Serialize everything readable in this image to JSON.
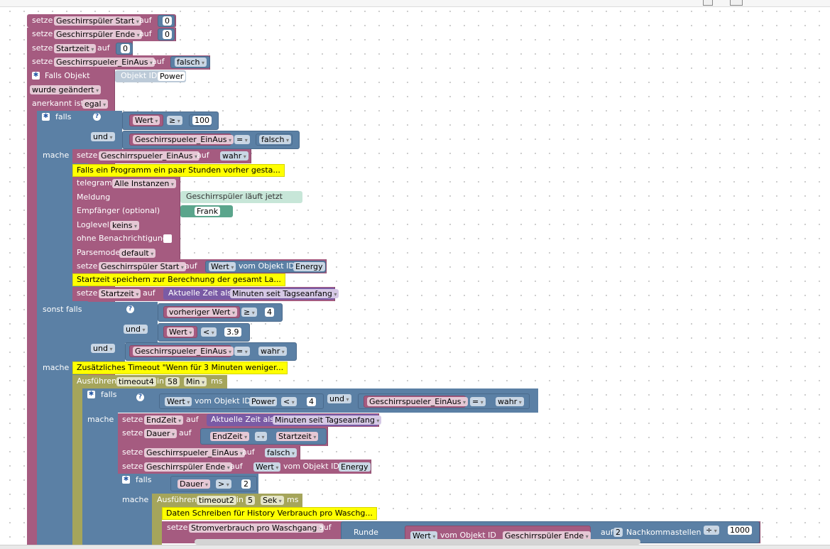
{
  "colors": {
    "variable": "#a55b80",
    "logic": "#5b80a5",
    "timeout": "#a5a55b",
    "time": "#7a5ba5",
    "text": "#5ba58c",
    "comment": "#ffff00"
  },
  "k": {
    "setze": "setze",
    "auf": "auf",
    "falls": "falls",
    "sonst_falls": "sonst falls",
    "mache": "mache",
    "und": "und",
    "vom_objekt_id": "vom Objekt ID",
    "ausfuehren": "Ausführen",
    "in": "in",
    "ms": "ms",
    "falls_objekt": "Falls Objekt",
    "objekt_id": "Objekt ID",
    "wurde_geaendert": "wurde geändert",
    "anerkannt_ist": "anerkannt ist",
    "egal": "egal",
    "aktuelle_zeit_als": "Aktuelle Zeit als",
    "minuten_seit": "Minuten seit Tagseanfang",
    "runde": "Runde",
    "nachkommastellen": "Nachkommastellen"
  },
  "v": {
    "gs_start": "Geschirrspüler Start",
    "gs_ende": "Geschirrspüler Ende",
    "startzeit": "Startzeit",
    "einaus": "Geschirrspueler_EinAus",
    "wert": "Wert",
    "vorheriger_wert": "vorheriger Wert",
    "endzeit": "EndZeit",
    "dauer": "Dauer",
    "timeout4": "timeout4",
    "timeout2": "timeout2",
    "stromverbrauch": "Stromverbrauch pro Waschgang"
  },
  "lit": {
    "zero1": "0",
    "zero2": "0",
    "zero3": "0",
    "falsch": "falsch",
    "wahr": "wahr",
    "power": "Power",
    "energy": "Energy",
    "gte": "≥",
    "lt": "<",
    "eq": "=",
    "gt": ">",
    "minus": "-",
    "div": "÷",
    "n100": "100",
    "n4": "4",
    "n39": "3.9",
    "n58": "58",
    "n5": "5",
    "n2": "2",
    "n2b": "2",
    "n1000": "1000",
    "min": "Min",
    "sek": "Sek"
  },
  "telegram": {
    "label": "telegram",
    "instanzen": "Alle Instanzen",
    "meldung": "Meldung",
    "meldung_text": "Geschirrspüler läuft jetzt",
    "empfaenger": "Empfänger (optional)",
    "empfaenger_text": "Frank",
    "loglevel": "Loglevel",
    "loglevel_val": "keins",
    "ohne": "ohne Benachrichtigung",
    "parsemode": "Parsemode",
    "parsemode_val": "default"
  },
  "comments": {
    "c1": "Falls ein Programm ein paar Stunden vorher gesta...",
    "c2": "Startzeit speichern zur Berechnung der gesamt La...",
    "c3": "Zusätzliches Timeout \"Wenn für 3 Minuten weniger...",
    "c4": "Daten Schreiben für History Verbrauch pro Waschg..."
  }
}
